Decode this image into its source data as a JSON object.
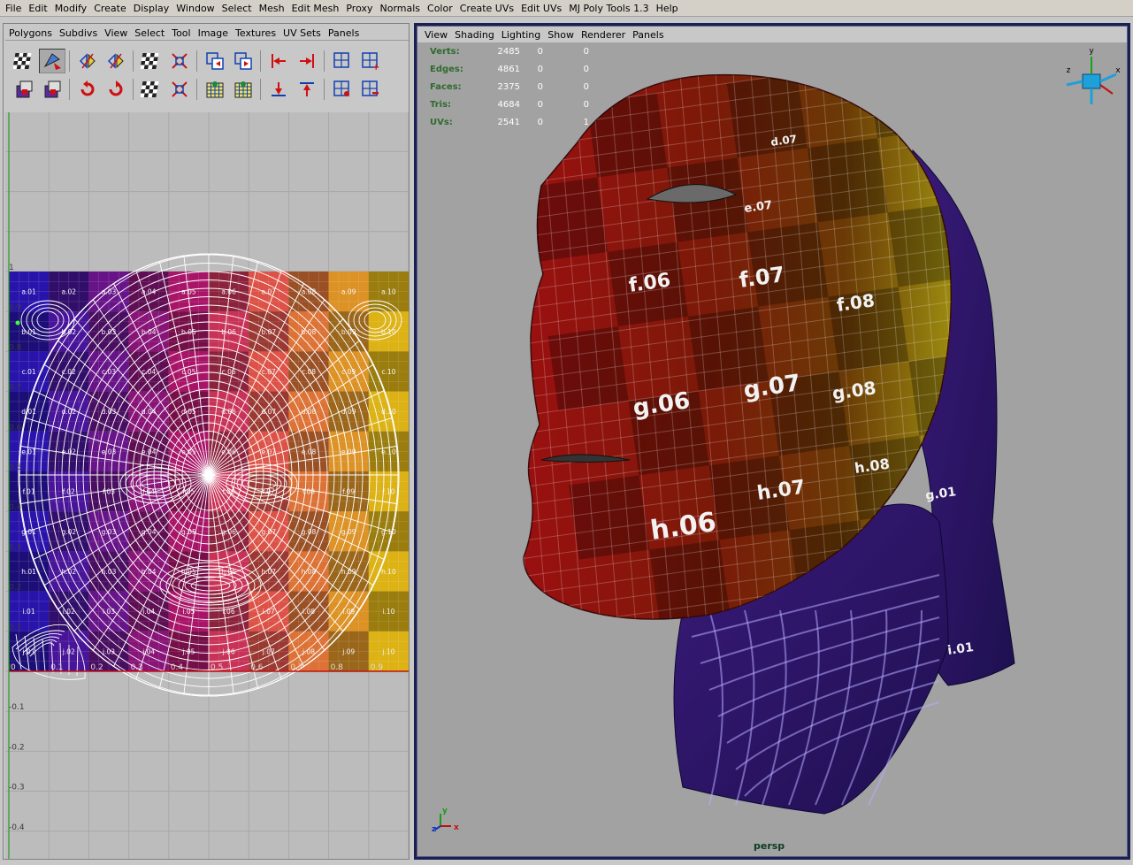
{
  "main_menu": [
    "File",
    "Edit",
    "Modify",
    "Create",
    "Display",
    "Window",
    "Select",
    "Mesh",
    "Edit Mesh",
    "Proxy",
    "Normals",
    "Color",
    "Create UVs",
    "Edit UVs",
    "MJ Poly Tools 1.3",
    "Help"
  ],
  "uv_editor": {
    "menu": [
      "Polygons",
      "Subdivs",
      "View",
      "Select",
      "Tool",
      "Image",
      "Textures",
      "UV Sets",
      "Panels"
    ],
    "toolbar_row1": [
      "checker-display-icon",
      "move-uv-shell-icon",
      "flip-uv-u-icon",
      "flip-uv-v-icon",
      "checker-cut-icon",
      "unfold-uv-icon",
      "copy-uvs-icon",
      "paste-uvs-icon",
      "align-left-icon",
      "align-right-icon",
      "grid-toggle-icon",
      "grid-add-icon"
    ],
    "toolbar_row2": [
      "texture-image-icon",
      "snapshot-icon",
      "rotate-ccw-icon",
      "rotate-cw-icon",
      "checker-sew-icon",
      "relax-uv-icon",
      "layout-uv-icon",
      "uv-lattice-icon",
      "align-bottom-icon",
      "align-top-icon",
      "grid-select-icon",
      "grid-remove-icon"
    ],
    "v_axis_labels": [
      "1",
      "0.9",
      "0.8",
      "0.7",
      "0.6",
      "0.5",
      "0.4",
      "0.3",
      "0.2",
      "0.1",
      "0",
      "-0.1",
      "-0.2",
      "-0.3",
      "-0.4"
    ],
    "u_axis_labels": [
      "0",
      "0.1",
      "0.2",
      "0.3",
      "0.4",
      "0.5",
      "0.6",
      "0.7",
      "0.8",
      "0.9"
    ],
    "texture_rows": [
      "a",
      "b",
      "c",
      "d",
      "e",
      "f",
      "g",
      "h",
      "i",
      "j"
    ],
    "texture_cols": [
      "01",
      "02",
      "03",
      "04",
      "05",
      "06",
      "07",
      "08",
      "09",
      "10"
    ]
  },
  "perspective": {
    "menu": [
      "View",
      "Shading",
      "Lighting",
      "Show",
      "Renderer",
      "Panels"
    ],
    "hud": [
      {
        "label": "Verts:",
        "value": "2485",
        "selected": "0",
        "uv": "0"
      },
      {
        "label": "Edges:",
        "value": "4861",
        "selected": "0",
        "uv": "0"
      },
      {
        "label": "Faces:",
        "value": "2375",
        "selected": "0",
        "uv": "0"
      },
      {
        "label": "Tris:",
        "value": "4684",
        "selected": "0",
        "uv": "0"
      },
      {
        "label": "UVs:",
        "value": "2541",
        "selected": "0",
        "uv": "1"
      }
    ],
    "camera": "persp",
    "view_cube_axes": [
      "y",
      "z",
      "x"
    ],
    "origin_axes": [
      "y",
      "z",
      "x"
    ],
    "face_tile_labels": [
      "f.06",
      "f.07",
      "f.08",
      "g.06",
      "g.07",
      "g.08",
      "h.06",
      "h.07",
      "h.08",
      "d.07",
      "e.07",
      "g.01",
      "i.01"
    ]
  },
  "colors": {
    "menu_bg": "#d4d0c8",
    "panel_bg": "#c8c8c8",
    "viewport_bg": "#a2a2a2",
    "active_border": "#1a2050",
    "hud_label": "#2e6b2e",
    "camera_label": "#0d3b22"
  }
}
